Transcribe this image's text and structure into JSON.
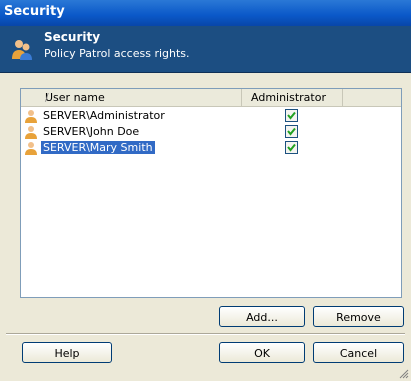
{
  "window": {
    "title": "Security"
  },
  "header": {
    "title": "Security",
    "subtitle": "Policy Patrol access rights."
  },
  "list": {
    "columns": [
      "User name",
      "Administrator"
    ],
    "sort_marker": "/",
    "rows": [
      {
        "name": "SERVER\\Administrator",
        "admin": true,
        "selected": false
      },
      {
        "name": "SERVER\\John Doe",
        "admin": true,
        "selected": false
      },
      {
        "name": "SERVER\\Mary Smith",
        "admin": true,
        "selected": true
      }
    ]
  },
  "buttons": {
    "add": "Add...",
    "remove": "Remove",
    "help": "Help",
    "ok": "OK",
    "cancel": "Cancel"
  },
  "colors": {
    "title_bar": "#0a58c8",
    "header_bg": "#1c4e82",
    "selection": "#316ac5"
  },
  "icons": [
    "users-icon",
    "user-icon",
    "checkbox-checked-icon",
    "resize-grip-icon"
  ]
}
